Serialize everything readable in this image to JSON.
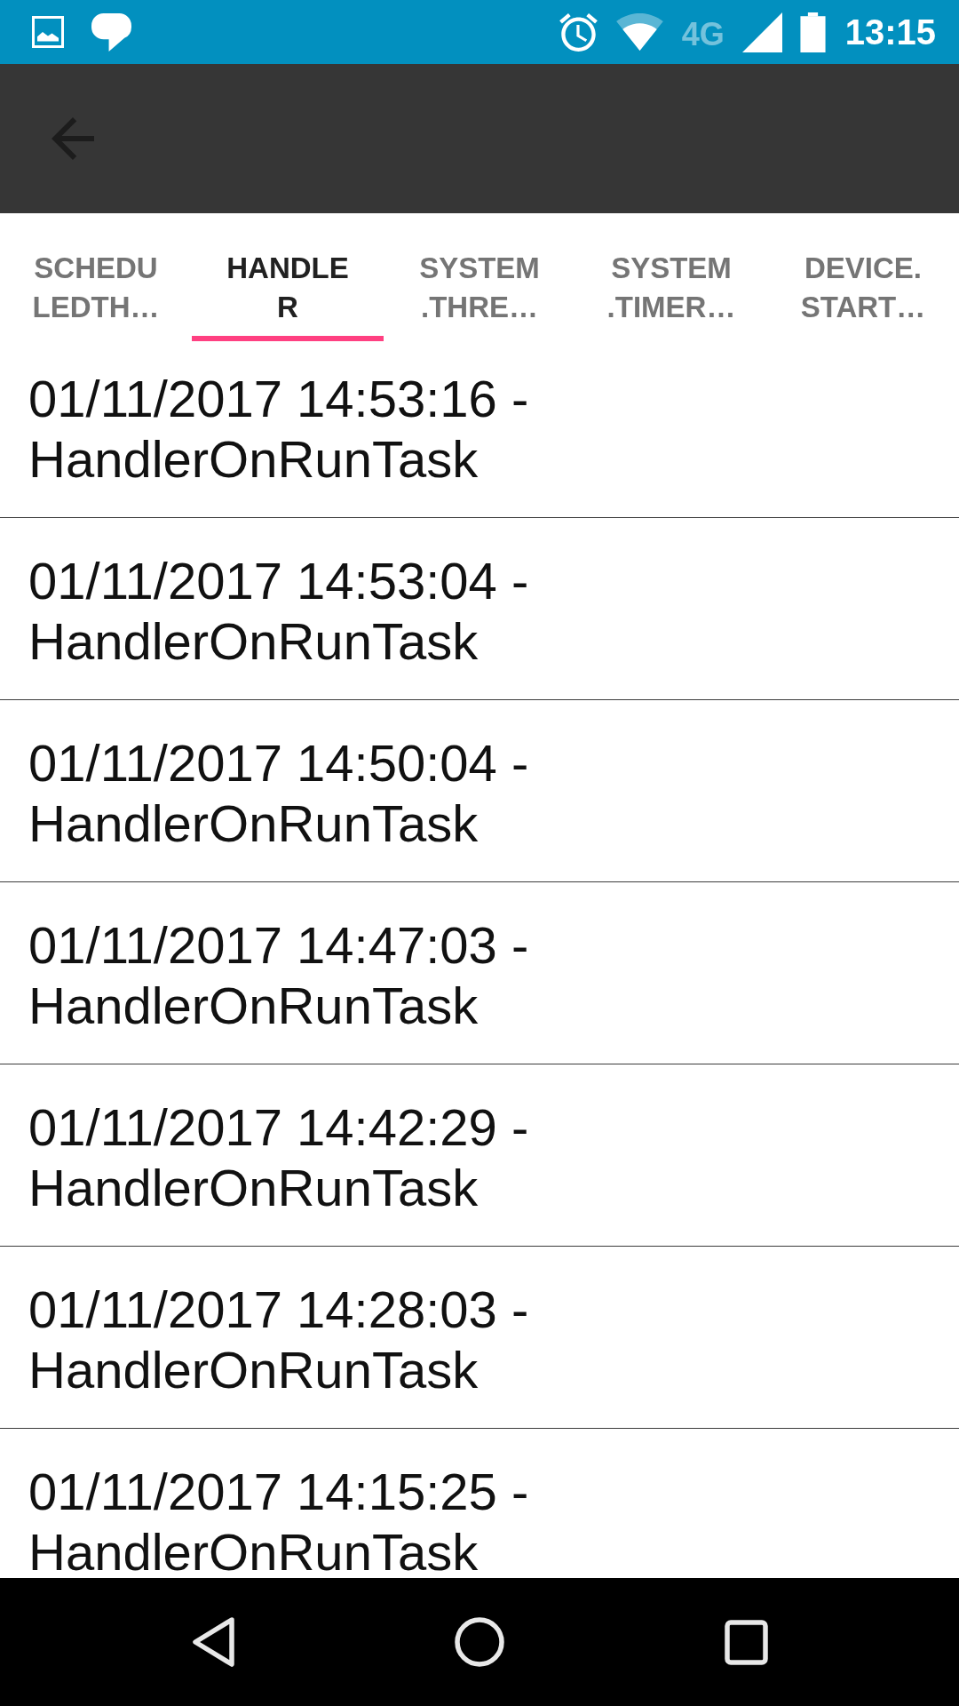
{
  "status_bar": {
    "network_type": "4G",
    "time": "13:15"
  },
  "tabs": [
    {
      "label": "SCHEDU\nLEDTH…",
      "selected": false
    },
    {
      "label": "HANDLE\nR",
      "selected": true
    },
    {
      "label": "SYSTEM\n.THRE…",
      "selected": false
    },
    {
      "label": "SYSTEM\n.TIMER…",
      "selected": false
    },
    {
      "label": "DEVICE.\nSTART…",
      "selected": false
    }
  ],
  "log_entries": [
    "01/11/2017 14:53:16 - HandlerOnRunTask",
    "01/11/2017 14:53:04 - HandlerOnRunTask",
    "01/11/2017 14:50:04 - HandlerOnRunTask",
    "01/11/2017 14:47:03 - HandlerOnRunTask",
    "01/11/2017 14:42:29 - HandlerOnRunTask",
    "01/11/2017 14:28:03 - HandlerOnRunTask",
    "01/11/2017 14:15:25 - HandlerOnRunTask"
  ]
}
